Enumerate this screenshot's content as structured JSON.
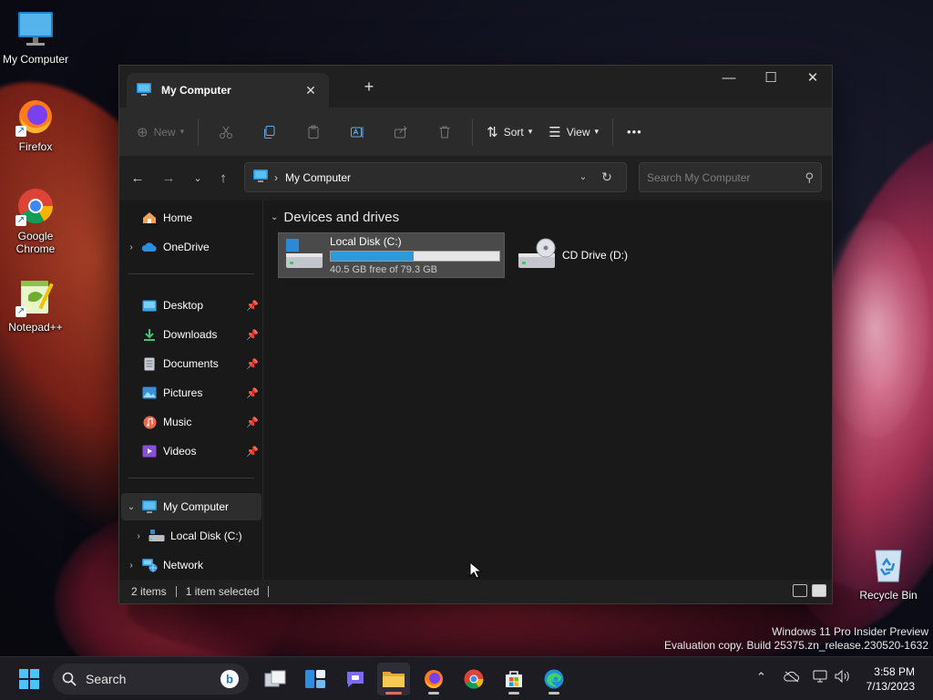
{
  "desktop": {
    "icons": [
      {
        "label": "My Computer"
      },
      {
        "label": "Firefox"
      },
      {
        "label": "Google Chrome"
      },
      {
        "label": "Notepad++"
      },
      {
        "label": "Recycle Bin"
      }
    ],
    "watermark": {
      "line1": "Windows 11 Pro Insider Preview",
      "line2": "Evaluation copy. Build 25375.zn_release.230520-1632"
    }
  },
  "window": {
    "tab_title": "My Computer",
    "tab_close": "✕",
    "new_tab": "+",
    "controls": {
      "minimize": "—",
      "maximize": "☐",
      "close": "✕"
    },
    "toolbar": {
      "new_label": "New",
      "sort_label": "Sort",
      "view_label": "View",
      "more_label": "•••"
    },
    "address": {
      "path": "My Computer"
    },
    "search": {
      "placeholder": "Search My Computer"
    },
    "sidebar": {
      "home": "Home",
      "onedrive": "OneDrive",
      "quick_access": [
        {
          "label": "Desktop"
        },
        {
          "label": "Downloads"
        },
        {
          "label": "Documents"
        },
        {
          "label": "Pictures"
        },
        {
          "label": "Music"
        },
        {
          "label": "Videos"
        }
      ],
      "my_computer": "My Computer",
      "local_disk": "Local Disk (C:)",
      "network": "Network"
    },
    "content": {
      "group_header": "Devices and drives",
      "drives": [
        {
          "name": "Local Disk (C:)",
          "free_text": "40.5 GB free of 79.3 GB",
          "used_fraction": 0.49
        },
        {
          "name": "CD Drive (D:)"
        }
      ]
    },
    "status": {
      "items": "2 items",
      "selected": "1 item selected"
    }
  },
  "taskbar": {
    "search_label": "Search",
    "time": "3:58 PM",
    "date": "7/13/2023"
  },
  "colors": {
    "accent": "#2b9ad8",
    "taskbar_active": "#e06a5c",
    "window_bg": "#191919"
  }
}
